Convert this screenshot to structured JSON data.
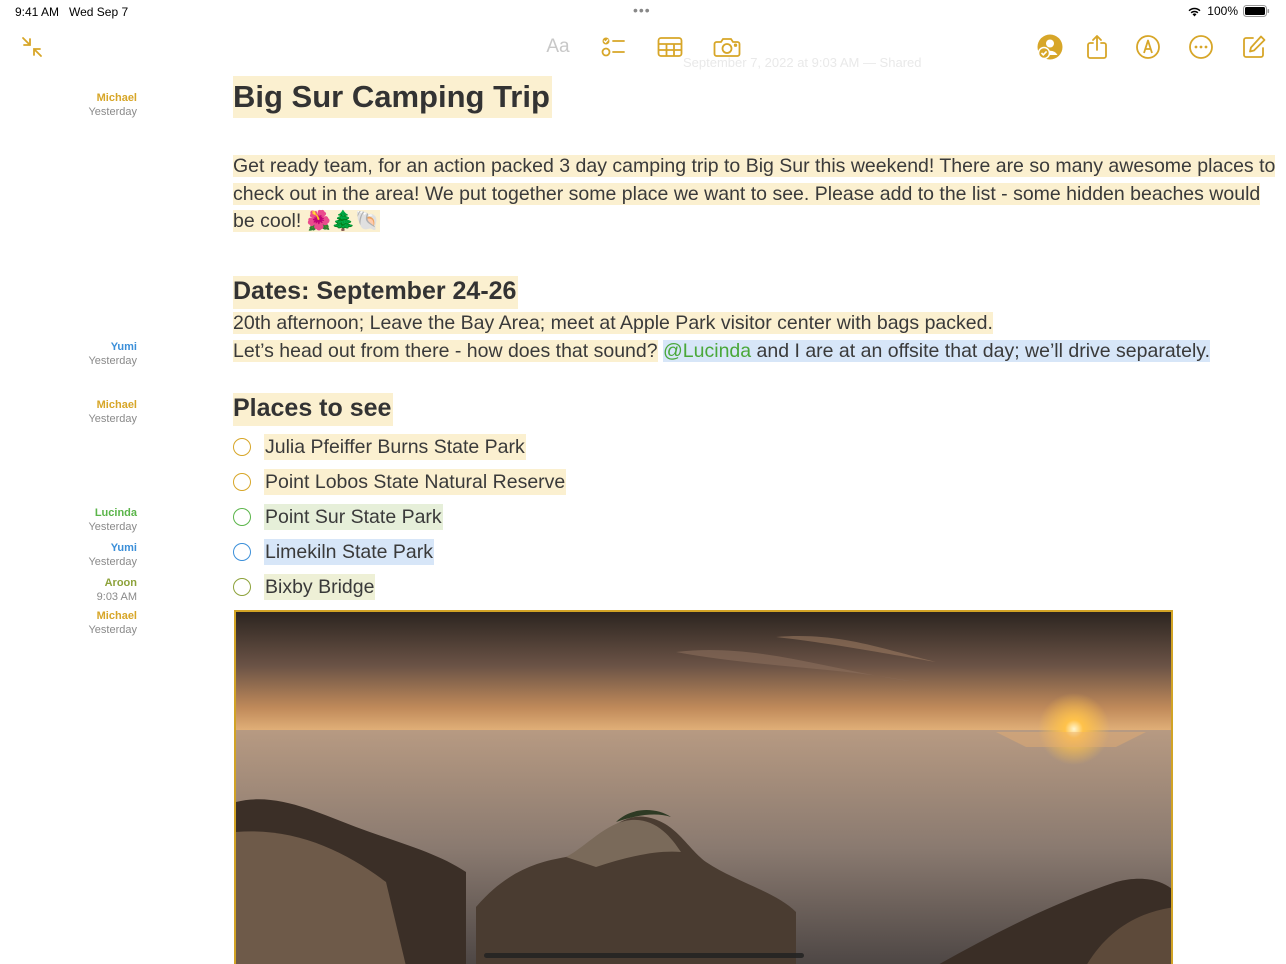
{
  "status": {
    "time": "9:41 AM",
    "date": "Wed Sep 7",
    "battery": "100%"
  },
  "toolbar": {
    "format_label": "Aa",
    "ghost_meta": "September 7, 2022 at 9:03 AM — Shared",
    "icons": [
      "collapse-icon",
      "checklist-icon",
      "table-icon",
      "camera-icon",
      "collaborate-icon",
      "share-icon",
      "markup-icon",
      "more-icon",
      "compose-icon"
    ]
  },
  "authors": [
    {
      "name": "Michael",
      "time": "Yesterday",
      "color": "#d7a628"
    },
    {
      "name": "Yumi",
      "time": "Yesterday",
      "color": "#3b8fd9"
    },
    {
      "name": "Michael",
      "time": "Yesterday",
      "color": "#d7a628"
    },
    {
      "name": "Lucinda",
      "time": "Yesterday",
      "color": "#5bb54a"
    },
    {
      "name": "Yumi",
      "time": "Yesterday",
      "color": "#3b8fd9"
    },
    {
      "name": "Aroon",
      "time": "9:03 AM",
      "color": "#8da23a"
    },
    {
      "name": "Michael",
      "time": "Yesterday",
      "color": "#d7a628"
    }
  ],
  "note": {
    "title": "Big Sur Camping Trip",
    "intro": "Get ready team, for an action packed 3 day camping trip to Big Sur this weekend! There are so many awesome places to check out in the area! We put together some place we want to see. Please add to the list - some hidden beaches would be cool! 🌺🌲🐚",
    "dates_heading": "Dates: September 24-26",
    "dates_line1": "20th afternoon; Leave the Bay Area; meet at Apple Park visitor center with bags packed.",
    "dates_line2": "Let’s head out from there - how does that sound?",
    "mention": "@Lucinda",
    "dates_line2_reply": " and I are at an offsite that day; we’ll drive separately.",
    "places_heading": "Places to see",
    "places": [
      {
        "label": "Julia Pfeiffer Burns State Park",
        "checked": false
      },
      {
        "label": "Point Lobos State Natural Reserve",
        "checked": false
      },
      {
        "label": "Point Sur State Park",
        "checked": false
      },
      {
        "label": "Limekiln State Park",
        "checked": false
      },
      {
        "label": "Bixby Bridge",
        "checked": false
      }
    ]
  },
  "colors": {
    "accent": "#d7a628",
    "highlight_yellow": "#fbf0d0",
    "highlight_blue": "#d7e6f8",
    "highlight_green": "#e6efd9"
  }
}
